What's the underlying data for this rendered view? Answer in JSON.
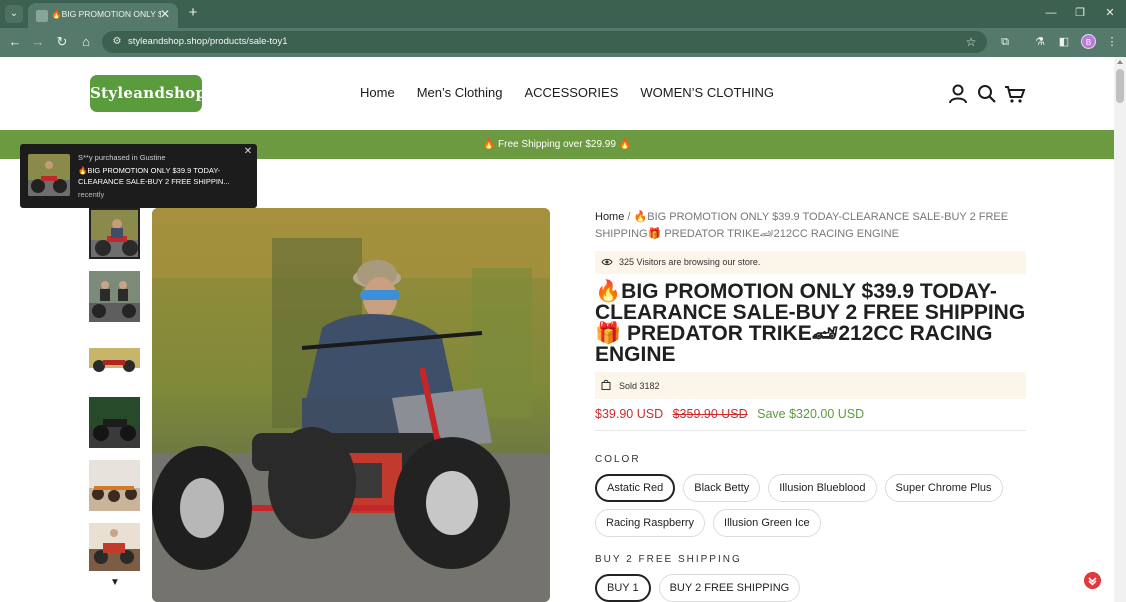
{
  "browser": {
    "tab_title": "🔥BIG PROMOTION ONLY $39.9",
    "url": "styleandshop.shop/products/sale-toy1",
    "profile_initial": "B"
  },
  "header": {
    "logo_text": "Styleandshop",
    "nav": [
      "Home",
      "Men’s Clothing",
      "ACCESSORIES",
      "WOMEN’S CLOTHING"
    ]
  },
  "banner": {
    "text": "🔥 Free Shipping over $29.99 🔥"
  },
  "popup": {
    "buyer_line": "S**y purchased in Gustine",
    "product_line": "🔥BIG PROMOTION ONLY $39.9 TODAY-CLEARANCE SALE-BUY 2 FREE SHIPPIN...",
    "time": "recently"
  },
  "product": {
    "breadcrumb_home": "Home",
    "breadcrumb_sep": "/",
    "breadcrumb_current": "🔥BIG PROMOTION ONLY $39.9 TODAY-CLEARANCE SALE-BUY 2 FREE SHIPPING🎁 PREDATOR TRIKE🏎212CC RACING ENGINE",
    "visitors_text": "325 Visitors are browsing our store.",
    "title": "🔥BIG PROMOTION ONLY $39.9 TODAY-CLEARANCE SALE-BUY 2 FREE SHIPPING🎁 PREDATOR TRIKE🏎212CC RACING ENGINE",
    "sold_text": "Sold 3182",
    "price": "$39.90 USD",
    "compare_price": "$359.90 USD",
    "savings": "Save $320.00 USD",
    "color_label": "COLOR",
    "colors": [
      "Astatic Red",
      "Black Betty",
      "Illusion Blueblood",
      "Super Chrome Plus",
      "Racing Raspberry",
      "Illusion Green Ice"
    ],
    "selected_color": "Astatic Red",
    "bundle_label": "BUY 2 FREE SHIPPING",
    "bundles": [
      "BUY 1",
      "BUY 2 FREE SHIPPING"
    ],
    "selected_bundle": "BUY 1"
  },
  "colors": {
    "brand_green": "#5a9c3c",
    "banner_green": "#6b9a40",
    "price_red": "#d02a2a",
    "browser_chrome": "#55796a"
  }
}
